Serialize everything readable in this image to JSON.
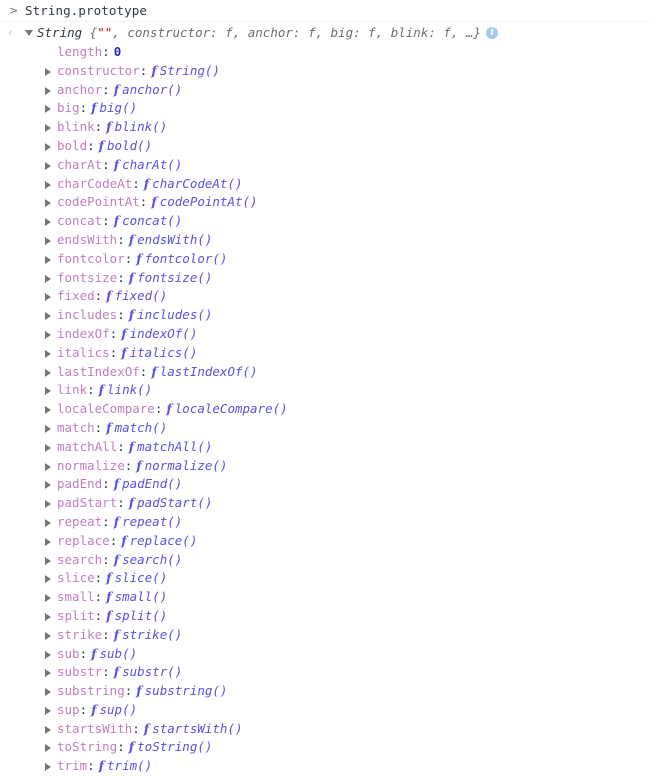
{
  "console": {
    "prompt_icon": "chevron-right-prompt-icon",
    "return_icon": "return-arrow-icon",
    "input": {
      "text": "String.prototype"
    },
    "result": {
      "expand_icon": "triangle-down-icon",
      "constructor_name": "String",
      "brace_open": " {",
      "empty_string": "\"\"",
      "preview": ", constructor: f, anchor: f, big: f, blink: f, …}",
      "info_icon_label": "i"
    },
    "properties": [
      {
        "name": "length",
        "expandable": false,
        "value_type": "number",
        "value": "0"
      },
      {
        "name": "constructor",
        "expandable": true,
        "value_type": "function",
        "value": "String()"
      },
      {
        "name": "anchor",
        "expandable": true,
        "value_type": "function",
        "value": "anchor()"
      },
      {
        "name": "big",
        "expandable": true,
        "value_type": "function",
        "value": "big()"
      },
      {
        "name": "blink",
        "expandable": true,
        "value_type": "function",
        "value": "blink()"
      },
      {
        "name": "bold",
        "expandable": true,
        "value_type": "function",
        "value": "bold()"
      },
      {
        "name": "charAt",
        "expandable": true,
        "value_type": "function",
        "value": "charAt()"
      },
      {
        "name": "charCodeAt",
        "expandable": true,
        "value_type": "function",
        "value": "charCodeAt()"
      },
      {
        "name": "codePointAt",
        "expandable": true,
        "value_type": "function",
        "value": "codePointAt()"
      },
      {
        "name": "concat",
        "expandable": true,
        "value_type": "function",
        "value": "concat()"
      },
      {
        "name": "endsWith",
        "expandable": true,
        "value_type": "function",
        "value": "endsWith()"
      },
      {
        "name": "fontcolor",
        "expandable": true,
        "value_type": "function",
        "value": "fontcolor()"
      },
      {
        "name": "fontsize",
        "expandable": true,
        "value_type": "function",
        "value": "fontsize()"
      },
      {
        "name": "fixed",
        "expandable": true,
        "value_type": "function",
        "value": "fixed()"
      },
      {
        "name": "includes",
        "expandable": true,
        "value_type": "function",
        "value": "includes()"
      },
      {
        "name": "indexOf",
        "expandable": true,
        "value_type": "function",
        "value": "indexOf()"
      },
      {
        "name": "italics",
        "expandable": true,
        "value_type": "function",
        "value": "italics()"
      },
      {
        "name": "lastIndexOf",
        "expandable": true,
        "value_type": "function",
        "value": "lastIndexOf()"
      },
      {
        "name": "link",
        "expandable": true,
        "value_type": "function",
        "value": "link()"
      },
      {
        "name": "localeCompare",
        "expandable": true,
        "value_type": "function",
        "value": "localeCompare()"
      },
      {
        "name": "match",
        "expandable": true,
        "value_type": "function",
        "value": "match()"
      },
      {
        "name": "matchAll",
        "expandable": true,
        "value_type": "function",
        "value": "matchAll()"
      },
      {
        "name": "normalize",
        "expandable": true,
        "value_type": "function",
        "value": "normalize()"
      },
      {
        "name": "padEnd",
        "expandable": true,
        "value_type": "function",
        "value": "padEnd()"
      },
      {
        "name": "padStart",
        "expandable": true,
        "value_type": "function",
        "value": "padStart()"
      },
      {
        "name": "repeat",
        "expandable": true,
        "value_type": "function",
        "value": "repeat()"
      },
      {
        "name": "replace",
        "expandable": true,
        "value_type": "function",
        "value": "replace()"
      },
      {
        "name": "search",
        "expandable": true,
        "value_type": "function",
        "value": "search()"
      },
      {
        "name": "slice",
        "expandable": true,
        "value_type": "function",
        "value": "slice()"
      },
      {
        "name": "small",
        "expandable": true,
        "value_type": "function",
        "value": "small()"
      },
      {
        "name": "split",
        "expandable": true,
        "value_type": "function",
        "value": "split()"
      },
      {
        "name": "strike",
        "expandable": true,
        "value_type": "function",
        "value": "strike()"
      },
      {
        "name": "sub",
        "expandable": true,
        "value_type": "function",
        "value": "sub()"
      },
      {
        "name": "substr",
        "expandable": true,
        "value_type": "function",
        "value": "substr()"
      },
      {
        "name": "substring",
        "expandable": true,
        "value_type": "function",
        "value": "substring()"
      },
      {
        "name": "sup",
        "expandable": true,
        "value_type": "function",
        "value": "sup()"
      },
      {
        "name": "startsWith",
        "expandable": true,
        "value_type": "function",
        "value": "startsWith()"
      },
      {
        "name": "toString",
        "expandable": true,
        "value_type": "function",
        "value": "toString()"
      },
      {
        "name": "trim",
        "expandable": true,
        "value_type": "function",
        "value": "trim()"
      }
    ],
    "colors": {
      "property_name": "#bf7fbf",
      "function_value": "#5b52e0",
      "number_value": "#2b25c4",
      "string_value": "#c41a16",
      "preview_text": "#6e6e6e",
      "info_badge": "#a3c8f0",
      "background": "#ffffff"
    }
  }
}
